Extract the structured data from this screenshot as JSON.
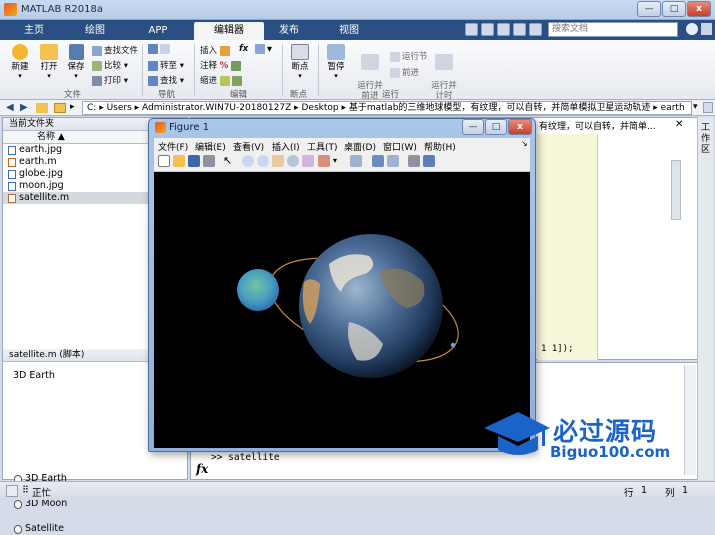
{
  "window": {
    "title": "MATLAB R2018a",
    "min": "—",
    "max": "□",
    "close": "x"
  },
  "tabs": [
    {
      "label": "主页"
    },
    {
      "label": "绘图"
    },
    {
      "label": "APP"
    },
    {
      "label": "编辑器"
    },
    {
      "label": "发布"
    },
    {
      "label": "视图"
    }
  ],
  "search": {
    "placeholder": "搜索文档"
  },
  "ribbon": {
    "file": {
      "new": "新建",
      "open": "打开",
      "save": "保存",
      "find_files": "查找文件",
      "compare": "比较",
      "print": "打印",
      "group": "文件"
    },
    "navigate": {
      "goto": "转至",
      "find": "查找",
      "group": "导航"
    },
    "edit": {
      "insert": "插入",
      "comment": "注释",
      "indent": "缩进",
      "fx": "fx",
      "group": "编辑"
    },
    "breakpoints": {
      "label": "断点",
      "group": "断点"
    },
    "run": {
      "pause": "暂停",
      "run_advance": "运行并\n前进",
      "run_section": "运行节",
      "advance": "前进",
      "run_time": "运行并\n计时",
      "group": "运行"
    }
  },
  "address": {
    "segments": [
      "C:",
      "Users",
      "Administrator.WIN7U-20180127Z",
      "Desktop",
      "基于matlab的三维地球模型，有纹理，可以自转，并简单模拟卫星运动轨迹",
      "earth"
    ]
  },
  "current_folder": {
    "title": "当前文件夹",
    "column": "名称 ▲",
    "files": [
      {
        "name": "earth.jpg"
      },
      {
        "name": "earth.m"
      },
      {
        "name": "globe.jpg"
      },
      {
        "name": "moon.jpg"
      },
      {
        "name": "satellite.m"
      }
    ]
  },
  "details": {
    "title": "satellite.m  (脚本)",
    "root": "3D Earth",
    "items": [
      {
        "name": "3D Earth"
      },
      {
        "name": "3D Moon"
      },
      {
        "name": "Satellite"
      }
    ]
  },
  "editor": {
    "tab_text": "型，有纹理，可以自转，并简单...",
    "code_fragment": "1 1]);"
  },
  "command_window": {
    "prompt": ">> satellite",
    "fx": "fx"
  },
  "workspace_label": "工作区",
  "status": {
    "text": "正忙",
    "row_label": "行",
    "row": "1",
    "col_label": "列",
    "col": "1"
  },
  "figure": {
    "title": "Figure 1",
    "menu": [
      {
        "label": "文件(F)"
      },
      {
        "label": "编辑(E)"
      },
      {
        "label": "查看(V)"
      },
      {
        "label": "插入(I)"
      },
      {
        "label": "工具(T)"
      },
      {
        "label": "桌面(D)"
      },
      {
        "label": "窗口(W)"
      },
      {
        "label": "帮助(H)"
      }
    ]
  },
  "watermark": {
    "text": "必过源码",
    "url": "Biguo100.com"
  },
  "colors": {
    "tab_bar": "#2a4f82",
    "accent": "#1a64c9",
    "canvas": "#000000"
  }
}
